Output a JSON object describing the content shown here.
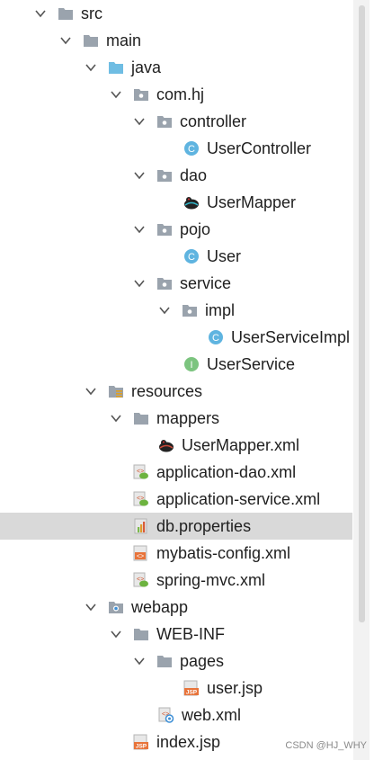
{
  "tree": {
    "rows": [
      {
        "id": "src",
        "label": "src",
        "icon": "folder-icon",
        "expanded": true
      },
      {
        "id": "main",
        "label": "main",
        "icon": "folder-icon",
        "expanded": true
      },
      {
        "id": "java",
        "label": "java",
        "icon": "source-folder-icon",
        "expanded": true
      },
      {
        "id": "com-hj",
        "label": "com.hj",
        "icon": "package-icon",
        "expanded": true
      },
      {
        "id": "controller",
        "label": "controller",
        "icon": "package-icon",
        "expanded": true
      },
      {
        "id": "user-controller",
        "label": "UserController",
        "icon": "class-icon"
      },
      {
        "id": "dao",
        "label": "dao",
        "icon": "package-icon",
        "expanded": true
      },
      {
        "id": "user-mapper",
        "label": "UserMapper",
        "icon": "mybatis-mapper-icon"
      },
      {
        "id": "pojo",
        "label": "pojo",
        "icon": "package-icon",
        "expanded": true
      },
      {
        "id": "user",
        "label": "User",
        "icon": "class-icon"
      },
      {
        "id": "service",
        "label": "service",
        "icon": "package-icon",
        "expanded": true
      },
      {
        "id": "impl",
        "label": "impl",
        "icon": "package-icon",
        "expanded": true
      },
      {
        "id": "user-service-impl",
        "label": "UserServiceImpl",
        "icon": "class-icon"
      },
      {
        "id": "user-service",
        "label": "UserService",
        "icon": "interface-icon"
      },
      {
        "id": "resources",
        "label": "resources",
        "icon": "resources-folder-icon",
        "expanded": true
      },
      {
        "id": "mappers",
        "label": "mappers",
        "icon": "folder-icon",
        "expanded": true
      },
      {
        "id": "user-mapper-xml",
        "label": "UserMapper.xml",
        "icon": "mybatis-xml-icon"
      },
      {
        "id": "application-dao-xml",
        "label": "application-dao.xml",
        "icon": "spring-xml-icon"
      },
      {
        "id": "application-service-xml",
        "label": "application-service.xml",
        "icon": "spring-xml-icon"
      },
      {
        "id": "db-properties",
        "label": "db.properties",
        "icon": "properties-icon",
        "selected": true
      },
      {
        "id": "mybatis-config-xml",
        "label": "mybatis-config.xml",
        "icon": "xml-icon"
      },
      {
        "id": "spring-mvc-xml",
        "label": "spring-mvc.xml",
        "icon": "spring-xml-icon"
      },
      {
        "id": "webapp",
        "label": "webapp",
        "icon": "web-folder-icon",
        "expanded": true
      },
      {
        "id": "web-inf",
        "label": "WEB-INF",
        "icon": "folder-icon",
        "expanded": true
      },
      {
        "id": "pages",
        "label": "pages",
        "icon": "folder-icon",
        "expanded": true
      },
      {
        "id": "user-jsp",
        "label": "user.jsp",
        "icon": "jsp-icon"
      },
      {
        "id": "web-xml",
        "label": "web.xml",
        "icon": "web-xml-icon"
      },
      {
        "id": "index-jsp",
        "label": "index.jsp",
        "icon": "jsp-icon"
      }
    ]
  },
  "watermark": "CSDN @HJ_WHY"
}
